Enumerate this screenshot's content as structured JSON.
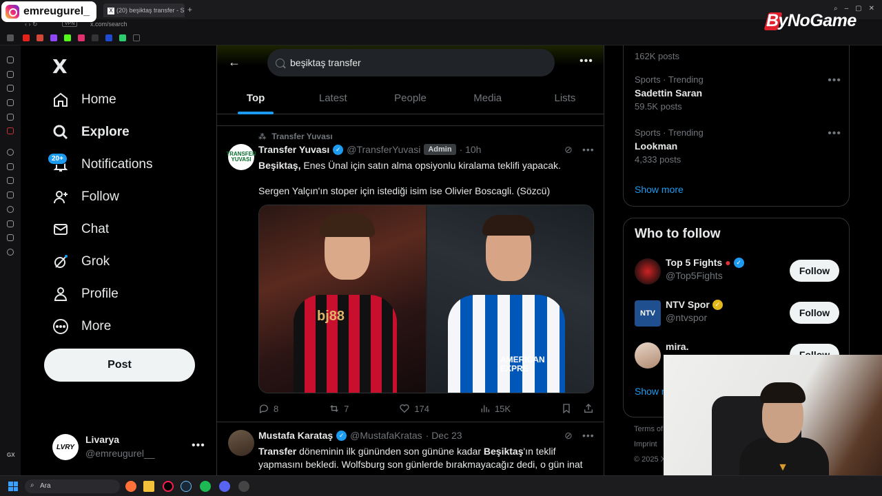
{
  "browser": {
    "tab_title": "(20) beşiktaş transfer - Se",
    "url": "x.com/search",
    "vpn_label": "VPN",
    "instagram_handle": "emreugurel_",
    "watermark": "ByNoGame",
    "rail_gx_label": "GX"
  },
  "sidebar": {
    "logo": "X",
    "items": [
      {
        "label": "Home",
        "icon": "home-icon"
      },
      {
        "label": "Explore",
        "icon": "search-icon"
      },
      {
        "label": "Notifications",
        "icon": "bell-icon",
        "badge": "20+"
      },
      {
        "label": "Follow",
        "icon": "person-add-icon"
      },
      {
        "label": "Chat",
        "icon": "mail-icon"
      },
      {
        "label": "Grok",
        "icon": "grok-icon"
      },
      {
        "label": "Profile",
        "icon": "person-icon"
      },
      {
        "label": "More",
        "icon": "more-circle-icon"
      }
    ],
    "post_button": "Post",
    "account": {
      "name": "Livarya",
      "handle": "@emreugurel__",
      "avatar_text": "LVRY"
    }
  },
  "main": {
    "search_query": "beşiktaş transfer",
    "tabs": [
      "Top",
      "Latest",
      "People",
      "Media",
      "Lists"
    ],
    "active_tab": "Top",
    "tweets": [
      {
        "repost_label": "Transfer Yuvası",
        "avatar_text": "TRANSFER YUVASI",
        "name": "Transfer Yuvası",
        "handle": "@TransferYuvasi",
        "badge": "Admin",
        "time": "· 10h",
        "text_bold": "Beşiktaş,",
        "text_rest": " Enes Ünal için satın alma opsiyonlu kiralama teklifi yapacak.",
        "text_2": "Sergen Yalçın'ın stoper için istediği isim ise Olivier Boscagli. (Sözcü)",
        "image_left_sponsor": "bj88",
        "image_right_sponsor": "AMERICAN EXPRE",
        "replies": "8",
        "reposts": "7",
        "likes": "174",
        "views": "15K"
      },
      {
        "name": "Mustafa Karataş",
        "handle": "@MustafaKratas",
        "time": "· Dec 23",
        "text_b1": "Transfer",
        "text_r1": " döneminin ilk gününden son gününe kadar ",
        "text_b2": "Beşiktaş",
        "text_r2": "'ın teklif yapmasını bekledi. Wolfsburg son günlerde bırakmayacağız dedi, o gün inat"
      }
    ]
  },
  "right": {
    "trends": [
      {
        "category": "",
        "title": "",
        "count": "162K posts"
      },
      {
        "category": "Sports · Trending",
        "title": "Sadettin Saran",
        "count": "59.5K posts"
      },
      {
        "category": "Sports · Trending",
        "title": "Lookman",
        "count": "4,333 posts"
      }
    ],
    "show_more": "Show more",
    "who_to_follow": {
      "title": "Who to follow",
      "accounts": [
        {
          "name": "Top 5 Fights",
          "handle": "@Top5Fights",
          "button": "Follow",
          "verified": "blue"
        },
        {
          "name": "NTV Spor",
          "handle": "@ntvspor",
          "button": "Follow",
          "verified": "gold",
          "avatar_text": "NTV"
        },
        {
          "name": "mira.",
          "handle": "",
          "button": "Follow"
        }
      ],
      "show_more": "Show m"
    },
    "footer": [
      "Terms of",
      "Imprint",
      "© 2025 X"
    ]
  },
  "taskbar": {
    "search_label": "Ara"
  },
  "colors": {
    "accent": "#1d9bf0",
    "background": "#000000",
    "border": "#2f3336",
    "muted": "#71767b"
  }
}
